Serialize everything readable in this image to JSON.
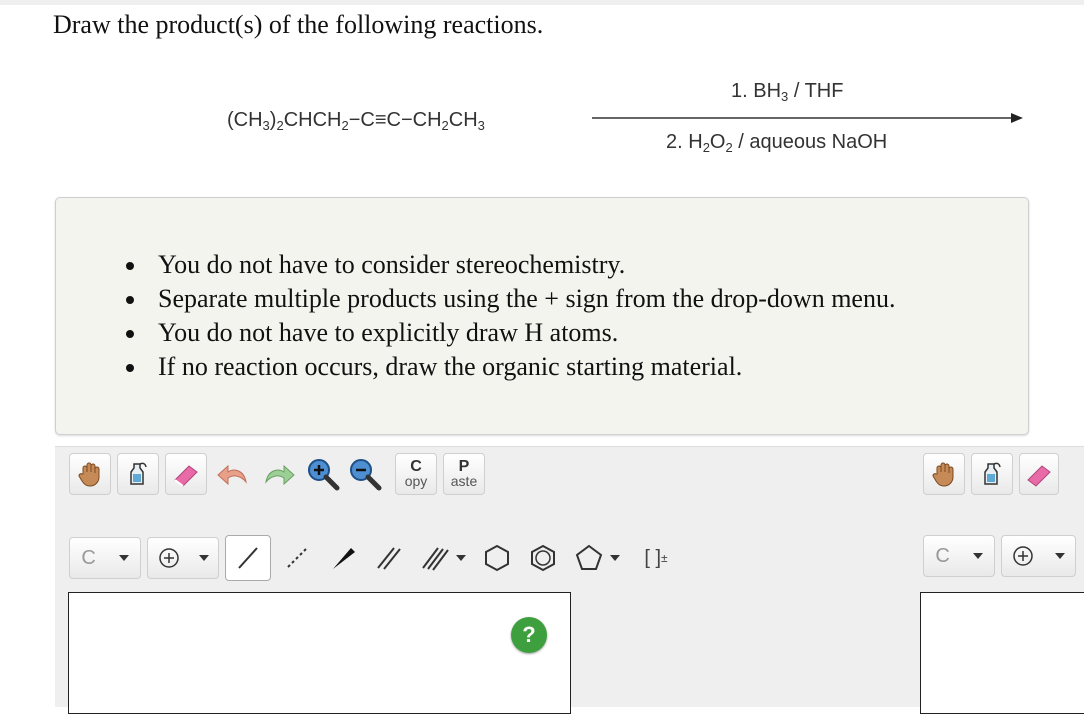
{
  "question": {
    "title": "Draw the product(s) of the following reactions."
  },
  "reaction": {
    "reactant_parts": [
      "(CH",
      "3",
      ")",
      "2",
      "CHCH",
      "2",
      "−C≡C−CH",
      "2",
      "CH",
      "3"
    ],
    "reagent1": [
      "1. BH",
      "3",
      " / THF"
    ],
    "reagent2": [
      "2. H",
      "2",
      "O",
      "2",
      " / aqueous NaOH"
    ]
  },
  "instructions": [
    "You do not have to consider stereochemistry.",
    "Separate multiple products using the + sign from the drop-down menu.",
    "You do not have to explicitly draw H atoms.",
    "If no reaction occurs, draw the organic starting material."
  ],
  "editor": {
    "copy_big": "C",
    "copy_small": "opy",
    "paste_big": "P",
    "paste_small": "aste",
    "atom_selected": "C",
    "bracket": "[ ]",
    "bracket_sup": "±",
    "help_label": "?"
  },
  "colors": {
    "help": "#3e9f3e",
    "eraser": "#e86aa6",
    "magnifier": "#2f6fb7"
  }
}
